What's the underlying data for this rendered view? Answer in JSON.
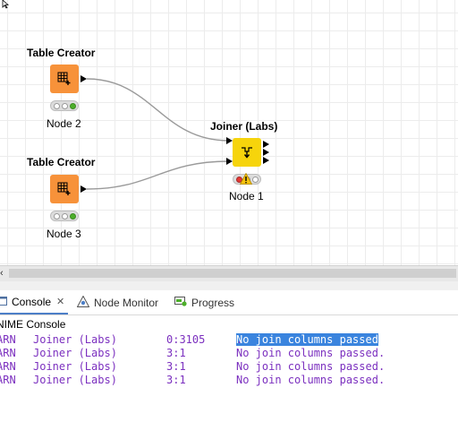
{
  "workflow": {
    "nodes": [
      {
        "id": "table-creator-1",
        "title": "Table Creator",
        "label": "Node 2",
        "kind": "table-creator",
        "status_lights": [
          "inactive",
          "inactive",
          "green"
        ]
      },
      {
        "id": "table-creator-2",
        "title": "Table Creator",
        "label": "Node 3",
        "kind": "table-creator",
        "status_lights": [
          "inactive",
          "inactive",
          "green"
        ]
      },
      {
        "id": "joiner",
        "title": "Joiner (Labs)",
        "label": "Node 1",
        "kind": "joiner",
        "status_lights": [
          "red",
          "inactive",
          "inactive"
        ],
        "warning": true
      }
    ]
  },
  "tabs": [
    {
      "label": "Console",
      "icon": "console-icon",
      "active": true,
      "closable": true
    },
    {
      "label": "Node Monitor",
      "icon": "node-monitor-icon",
      "active": false
    },
    {
      "label": "Progress",
      "icon": "progress-icon",
      "active": false
    }
  ],
  "console": {
    "header": "NIME Console",
    "lines": [
      {
        "level": "ARN",
        "node": "Joiner (Labs)",
        "id": "0:3105",
        "message_selected": "No join columns passed",
        "message_rest": "."
      },
      {
        "level": "ARN",
        "node": "Joiner (Labs)",
        "id": "3:1",
        "message_selected": "",
        "message_rest": "No join columns passed."
      },
      {
        "level": "ARN",
        "node": "Joiner (Labs)",
        "id": "3:1",
        "message_selected": "",
        "message_rest": "No join columns passed."
      },
      {
        "level": "ARN",
        "node": "Joiner (Labs)",
        "id": "3:1",
        "message_selected": "",
        "message_rest": "No join columns passed."
      }
    ]
  },
  "colors": {
    "table_creator": "#f7923a",
    "joiner": "#f6d40c",
    "console_text": "#7b2fbf",
    "selection": "#3a84de",
    "green_light": "#4caf2a",
    "red_light": "#e53935"
  },
  "scrollbar": {
    "left_arrow": "‹"
  }
}
